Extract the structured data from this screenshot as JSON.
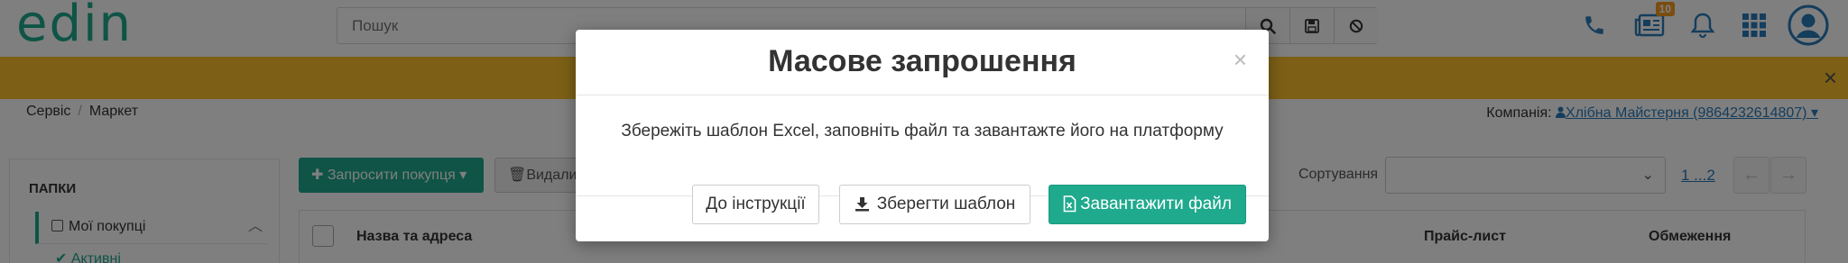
{
  "header": {
    "logo_text": "edin",
    "search_placeholder": "Пошук",
    "notifications_badge": "10"
  },
  "breadcrumb": {
    "items": [
      "Сервіс",
      "Маркет"
    ]
  },
  "company": {
    "label": "Компанія:",
    "value": "Хлібна Майстерня (9864232614807)"
  },
  "sidebar": {
    "folders_title": "ПАПКИ",
    "item_label": "Мої покупці",
    "sub_item_label": "Активні"
  },
  "toolbar": {
    "invite_label": "Запросити покупця",
    "delete_label": "Видали",
    "sort_label": "Сортування",
    "pager_text": "1 ...2"
  },
  "table": {
    "columns": [
      "Назва та адреса",
      "Прайс-лист",
      "Обмеження"
    ]
  },
  "modal": {
    "title": "Масове запрошення",
    "close_symbol": "×",
    "body_text": "Збережіть шаблон Excel, заповніть файл та завантажте його на платформу",
    "instructions_label": "До інструкції",
    "save_template_label": "Зберегти шаблон",
    "upload_file_label": "Завантажити файл"
  },
  "colors": {
    "brand_green": "#1fa98d",
    "banner_yellow": "#fbc02d",
    "link_blue": "#2a7ab8",
    "badge_orange": "#f59a23"
  }
}
